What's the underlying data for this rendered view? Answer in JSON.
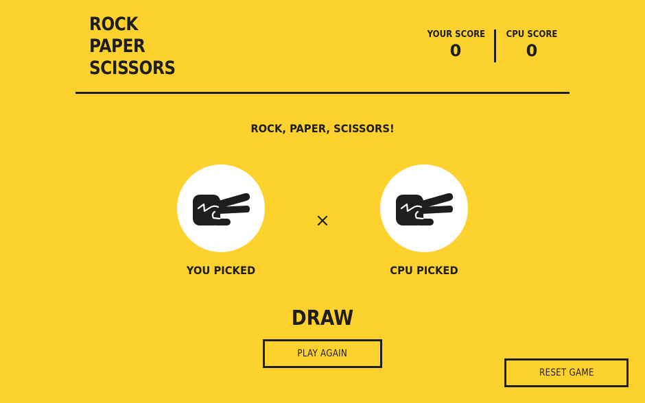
{
  "title": {
    "line1": "ROCK",
    "line2": "PAPER",
    "line3": "SCISSORS"
  },
  "scores": {
    "you_label": "YOUR SCORE",
    "you_value": "0",
    "cpu_label": "CPU SCORE",
    "cpu_value": "0"
  },
  "prompt": "ROCK, PAPER, SCISSORS!",
  "picks": {
    "you_icon": "scissors-hand-icon",
    "you_label": "YOU PICKED",
    "versus_symbol": "×",
    "cpu_icon": "scissors-hand-icon",
    "cpu_label": "CPU PICKED"
  },
  "result": "DRAW",
  "buttons": {
    "play_again": "PLAY AGAIN",
    "reset_game": "RESET GAME"
  },
  "colors": {
    "background": "#FDD22E",
    "foreground": "#1E1E1E",
    "circle": "#FFFFFF"
  }
}
